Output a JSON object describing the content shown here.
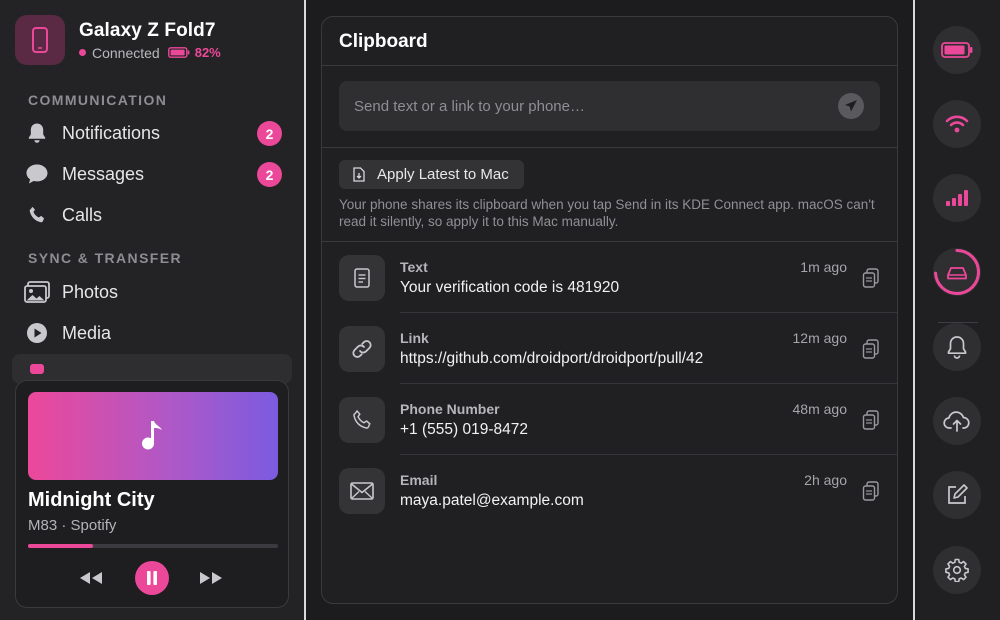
{
  "device": {
    "name": "Galaxy Z Fold7",
    "status": "Connected",
    "battery": "82%",
    "battery_level": 0.82,
    "icon": "phone-icon"
  },
  "sidebar": {
    "sections": [
      {
        "title": "COMMUNICATION",
        "items": [
          {
            "label": "Notifications",
            "icon": "bell-icon",
            "badge": "2"
          },
          {
            "label": "Messages",
            "icon": "chat-bubble-icon",
            "badge": "2"
          },
          {
            "label": "Calls",
            "icon": "phone-handset-icon"
          }
        ]
      },
      {
        "title": "SYNC & TRANSFER",
        "items": [
          {
            "label": "Photos",
            "icon": "photos-icon"
          },
          {
            "label": "Media",
            "icon": "play-circle-icon"
          }
        ]
      }
    ]
  },
  "player": {
    "title": "Midnight City",
    "subtitle": "M83 · Spotify",
    "progress": 0.26,
    "art_icon": "music-note-icon"
  },
  "clipboard": {
    "title": "Clipboard",
    "send_placeholder": "Send text or a link to your phone…",
    "apply_label": "Apply Latest to Mac",
    "hint": "Your phone shares its clipboard when you tap Send in its KDE Connect app. macOS can't read it silently, so apply it to this Mac manually.",
    "items": [
      {
        "type": "Text",
        "value": "Your verification code is 481920",
        "time": "1m ago",
        "icon": "document-icon"
      },
      {
        "type": "Link",
        "value": "https://github.com/droidport/droidport/pull/42",
        "time": "12m ago",
        "icon": "link-icon"
      },
      {
        "type": "Phone Number",
        "value": "+1 (555) 019-8472",
        "time": "48m ago",
        "icon": "phone-handset-icon"
      },
      {
        "type": "Email",
        "value": "maya.patel@example.com",
        "time": "2h ago",
        "icon": "envelope-icon"
      }
    ]
  },
  "rail": [
    "battery-icon",
    "wifi-icon",
    "signal-icon",
    "storage-icon",
    "bell-icon",
    "cloud-upload-icon",
    "compose-icon",
    "gear-icon"
  ],
  "colors": {
    "accent": "#ec4899",
    "background": "#1c1c1e",
    "panel": "#202022"
  }
}
